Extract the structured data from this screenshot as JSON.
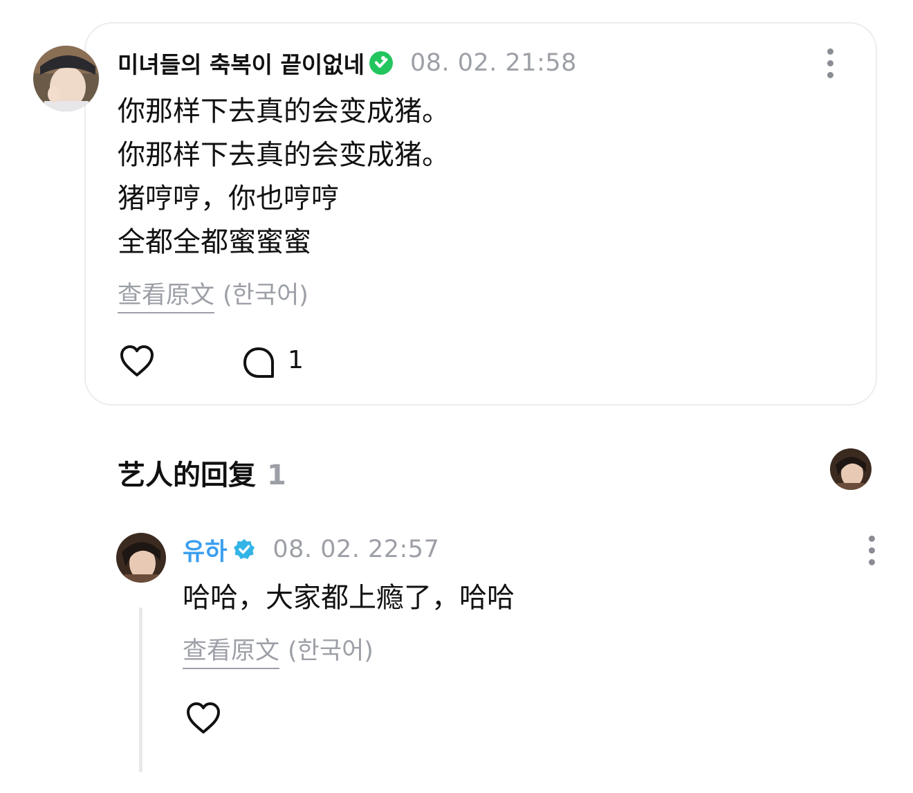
{
  "post": {
    "username": "미녀들의 축복이 끝이없네",
    "timestamp": "08. 02. 21:58",
    "lines": [
      "你那样下去真的会变成猪。",
      "你那样下去真的会变成猪。",
      "猪哼哼，你也哼哼",
      "全都全都蜜蜜蜜"
    ],
    "translate_link": "查看原文",
    "translate_lang": "(한국어)",
    "comment_count": "1"
  },
  "replies_section": {
    "title": "艺人的回复",
    "count": "1"
  },
  "reply": {
    "username": "유하",
    "timestamp": "08. 02. 22:57",
    "text": "哈哈，大家都上瘾了，哈哈",
    "translate_link": "查看原文",
    "translate_lang": "(한국어)"
  },
  "colors": {
    "verified_green": "#22c55e",
    "verified_blue": "#33b4e6",
    "reply_username": "#3a9ef0",
    "muted_text": "#9c9fa6",
    "card_border": "#ececf0"
  },
  "icons": {
    "post_like": "heart-outline-icon",
    "post_comment": "comment-bubble-icon",
    "more": "more-vertical-icon",
    "verified": "verified-badge-icon"
  }
}
